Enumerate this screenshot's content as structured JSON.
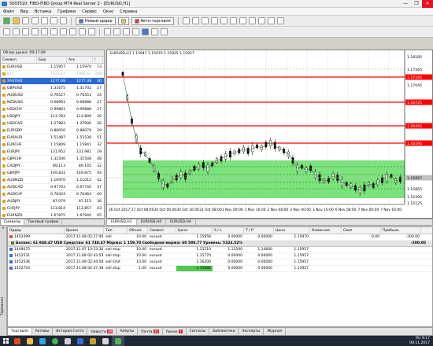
{
  "window": {
    "title": "5003510: FIBO-FIBO Group MT4 Real Server 2 - [EURUSD,H1]",
    "controls": [
      "—",
      "❐",
      "✕"
    ]
  },
  "menu": [
    "Файл",
    "Вид",
    "Вставка",
    "Графики",
    "Сервис",
    "Окно",
    "Справка"
  ],
  "toolbar": {
    "new_order": "Новый ордер",
    "autotrading": "Авто-торговля"
  },
  "market_watch": {
    "header": "Обзор рынка: 09:17:49",
    "columns": [
      "Символ",
      "Бид",
      "Аск",
      "!"
    ],
    "rows": [
      {
        "symbol": "EURUSD",
        "bid": "1.15957",
        "ask": "1.15970",
        "spread": "13",
        "state": "normal"
      },
      {
        "symbol": "BTC",
        "bid": "7331.67",
        "ask": "7366.67",
        "spread": "3500",
        "state": "dim"
      },
      {
        "symbol": "XAUUSD",
        "bid": "1277.08",
        "ask": "1277.38",
        "spread": "30",
        "state": "selected"
      },
      {
        "symbol": "GBPUSD",
        "bid": "1.31675",
        "ask": "1.31702",
        "spread": "27",
        "state": "normal"
      },
      {
        "symbol": "AUDUSD",
        "bid": "0.76527",
        "ask": "0.76551",
        "spread": "24",
        "state": "normal"
      },
      {
        "symbol": "NZDUSD",
        "bid": "0.68961",
        "ask": "0.68988",
        "spread": "27",
        "state": "normal"
      },
      {
        "symbol": "USDCHF",
        "bid": "0.99861",
        "ask": "0.99888",
        "spread": "27",
        "state": "normal"
      },
      {
        "symbol": "USDJPY",
        "bid": "113.783",
        "ask": "113.809",
        "spread": "26",
        "state": "normal"
      },
      {
        "symbol": "USDCAD",
        "bid": "1.27883",
        "ask": "1.27906",
        "spread": "26",
        "state": "normal"
      },
      {
        "symbol": "EURGBP",
        "bid": "0.88050",
        "ask": "0.88079",
        "spread": "29",
        "state": "normal"
      },
      {
        "symbol": "EURAUD",
        "bid": "1.51487",
        "ask": "1.51538",
        "spread": "51",
        "state": "normal"
      },
      {
        "symbol": "EURCHF",
        "bid": "1.15809",
        "ask": "1.15841",
        "spread": "32",
        "state": "normal"
      },
      {
        "symbol": "EURJPY",
        "bid": "131.952",
        "ask": "131.981",
        "spread": "29",
        "state": "normal"
      },
      {
        "symbol": "GBPCHF",
        "bid": "1.31500",
        "ask": "1.31548",
        "spread": "48",
        "state": "normal"
      },
      {
        "symbol": "CADJPY",
        "bid": "89.113",
        "ask": "89.145",
        "spread": "32",
        "state": "normal"
      },
      {
        "symbol": "GBPJPY",
        "bid": "149.831",
        "ask": "149.875",
        "spread": "44",
        "state": "normal"
      },
      {
        "symbol": "AUDNZD",
        "bid": "1.10970",
        "ask": "1.11012",
        "spread": "42",
        "state": "normal"
      },
      {
        "symbol": "AUDCAD",
        "bid": "0.97703",
        "ask": "0.97740",
        "spread": "37",
        "state": "normal"
      },
      {
        "symbol": "AUDCHF",
        "bid": "0.76424",
        "ask": "0.76464",
        "spread": "40",
        "state": "normal"
      },
      {
        "symbol": "AUDJPY",
        "bid": "87.079",
        "ask": "87.115",
        "spread": "36",
        "state": "normal"
      },
      {
        "symbol": "CHFJPY",
        "bid": "113.814",
        "ask": "113.857",
        "spread": "43",
        "state": "normal"
      },
      {
        "symbol": "EURNZD",
        "bid": "1.67875",
        "ask": "1.67940",
        "spread": "65",
        "state": "normal"
      }
    ],
    "tabs": [
      "Символы",
      "Тиковый график"
    ]
  },
  "chart": {
    "title": "EURUSD,H1  1.15947 1.15970 1.15925 1.15957",
    "tabs": [
      "EURUSD,H1",
      "EURUSD,H4",
      "EURUSD,H4"
    ],
    "price_labels": [
      "1.18185",
      "1.17445",
      "1.17245",
      "1.17045",
      "1.16725",
      "1.16455",
      "1.16195",
      "1.15957",
      "1.15665",
      "1.15395",
      "1.15125"
    ],
    "time_labels": [
      "26 Oct 2017",
      "27 Oct 08:00",
      "30 Oct 00:00",
      "30 Oct 16:00",
      "31 Oct 08:00",
      "1 Nov 00:00",
      "1 Nov 16:00",
      "2 Nov 08:00",
      "3 Nov 00:00",
      "3 Nov 16:00",
      "6 Nov 08:00",
      "7 Nov 00:00",
      "7 Nov 16:00"
    ],
    "colors": {
      "zone": "#7be37b",
      "level": "#ff0000",
      "bid": "#c0c0c0"
    }
  },
  "terminal": {
    "columns": [
      "Ордер",
      "Время",
      "Тип",
      "Объем",
      "Символ",
      "Цена",
      "S / L",
      "T / P",
      "Цена",
      "Комиссия",
      "Своп",
      "Прибыль"
    ],
    "open_rows": [
      {
        "order": "1452499",
        "time": "2017.11.08 02:27:40",
        "type": "sell",
        "volume": "10.00",
        "symbol": "eurusd",
        "price": "1.15958",
        "sl": "0.00000",
        "tp": "0.00000",
        "cur": "1.15970",
        "commission": "",
        "swap": "0.00",
        "profit": "-200.00"
      }
    ],
    "balance_text": "Баланс: 61 948.47 USD  Средства: 61 748.47  Маржа: 1 159.70  Свободная маржа: 60 588.77  Уровень: 5324.52%",
    "balance_profit": "-200.00",
    "pending_rows": [
      {
        "order": "1449075",
        "time": "2017.11.07 13:53:36",
        "type": "sell stop",
        "volume": "10.00",
        "symbol": "eurusd",
        "price": "1.15510",
        "sl": "1.15590",
        "tp": "1.14600",
        "cur": "1.15957",
        "highlight": false
      },
      {
        "order": "1452531",
        "time": "2017.11.08 02:43:53",
        "type": "sell stop",
        "volume": "10.00",
        "symbol": "eurusd",
        "price": "1.15770",
        "sl": "0.00000",
        "tp": "0.00000",
        "cur": "1.15957",
        "highlight": false
      },
      {
        "order": "1452536",
        "time": "2017.11.08 02:44:58",
        "type": "sell limit",
        "volume": "10.00",
        "symbol": "eurusd",
        "price": "1.16200",
        "sl": "0.00000",
        "tp": "0.00000",
        "cur": "1.15957",
        "highlight": false
      },
      {
        "order": "1452703",
        "time": "2017.11.08 04:47:38",
        "type": "sell stop",
        "volume": "1.00",
        "symbol": "eurusd",
        "price": "1.15880",
        "sl": "0.00000",
        "tp": "0.00000",
        "cur": "1.15957",
        "highlight": true
      }
    ],
    "side_label": "Терминал",
    "tabs": [
      {
        "label": "Торговля",
        "count": ""
      },
      {
        "label": "Активы",
        "count": ""
      },
      {
        "label": "История Счета",
        "count": ""
      },
      {
        "label": "Новости",
        "count": "99"
      },
      {
        "label": "Алерты",
        "count": ""
      },
      {
        "label": "Почта",
        "count": "10"
      },
      {
        "label": "Рынок",
        "count": "7"
      },
      {
        "label": "Сигналы",
        "count": ""
      },
      {
        "label": "Библиотека",
        "count": ""
      },
      {
        "label": "Эксперты",
        "count": ""
      },
      {
        "label": "Журнал",
        "count": ""
      }
    ]
  },
  "taskbar": {
    "time": "9:17",
    "date": "08.11.2017",
    "lang": "RU",
    "status_left": "Для получения справки нажмите F1",
    "status_mid": "Default",
    "status_right": "491/1 kb"
  }
}
